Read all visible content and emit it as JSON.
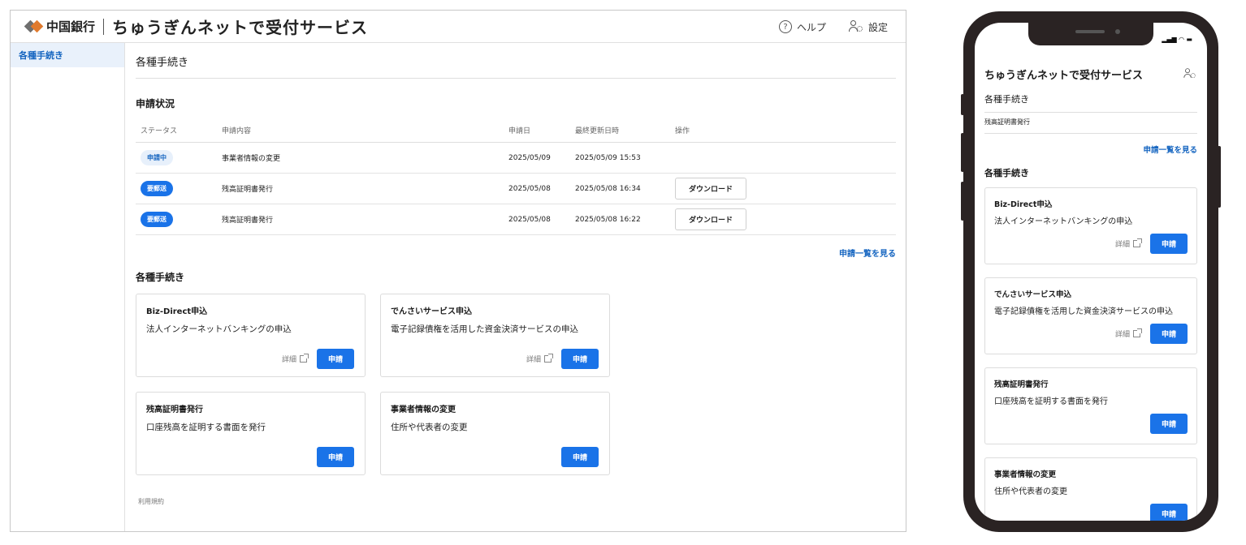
{
  "brand": {
    "bank_name": "中国銀行",
    "service_title": "ちゅうぎんネットで受付サービス"
  },
  "header": {
    "help_label": "ヘルプ",
    "settings_label": "設定"
  },
  "sidebar": {
    "items": [
      {
        "label": "各種手続き"
      }
    ]
  },
  "page_title": "各種手続き",
  "status_section": {
    "title": "申請状況",
    "columns": [
      "ステータス",
      "申請内容",
      "申請日",
      "最終更新日時",
      "操作"
    ],
    "rows": [
      {
        "status": "申請中",
        "content": "事業者情報の変更",
        "applied": "2025/05/09",
        "updated": "2025/05/09 15:53",
        "action": ""
      },
      {
        "status": "要郵送",
        "content": "残高証明書発行",
        "applied": "2025/05/08",
        "updated": "2025/05/08 16:34",
        "action": "ダウンロード"
      },
      {
        "status": "要郵送",
        "content": "残高証明書発行",
        "applied": "2025/05/08",
        "updated": "2025/05/08 16:22",
        "action": "ダウンロード"
      }
    ],
    "list_link": "申請一覧を見る"
  },
  "procedures": {
    "title": "各種手続き",
    "cards": [
      {
        "title": "Biz-Direct申込",
        "desc": "法人インターネットバンキングの申込",
        "detail": "詳細",
        "apply": "申請"
      },
      {
        "title": "でんさいサービス申込",
        "desc": "電子記録債権を活用した資金決済サービスの申込",
        "detail": "詳細",
        "apply": "申請"
      },
      {
        "title": "残高証明書発行",
        "desc": "口座残高を証明する書面を発行",
        "detail": "",
        "apply": "申請"
      },
      {
        "title": "事業者情報の変更",
        "desc": "住所や代表者の変更",
        "detail": "",
        "apply": "申請"
      }
    ]
  },
  "footer": {
    "terms": "利用規約"
  },
  "mobile": {
    "title": "ちゅうぎんネットで受付サービス",
    "page_title": "各種手続き",
    "tab": "残高証明書発行",
    "list_link": "申請一覧を見る",
    "section_title": "各種手続き"
  },
  "colors": {
    "accent": "#1a73e8",
    "link": "#1565c0",
    "logo_orange": "#e07a2e",
    "phone_frame": "#2a2323"
  }
}
